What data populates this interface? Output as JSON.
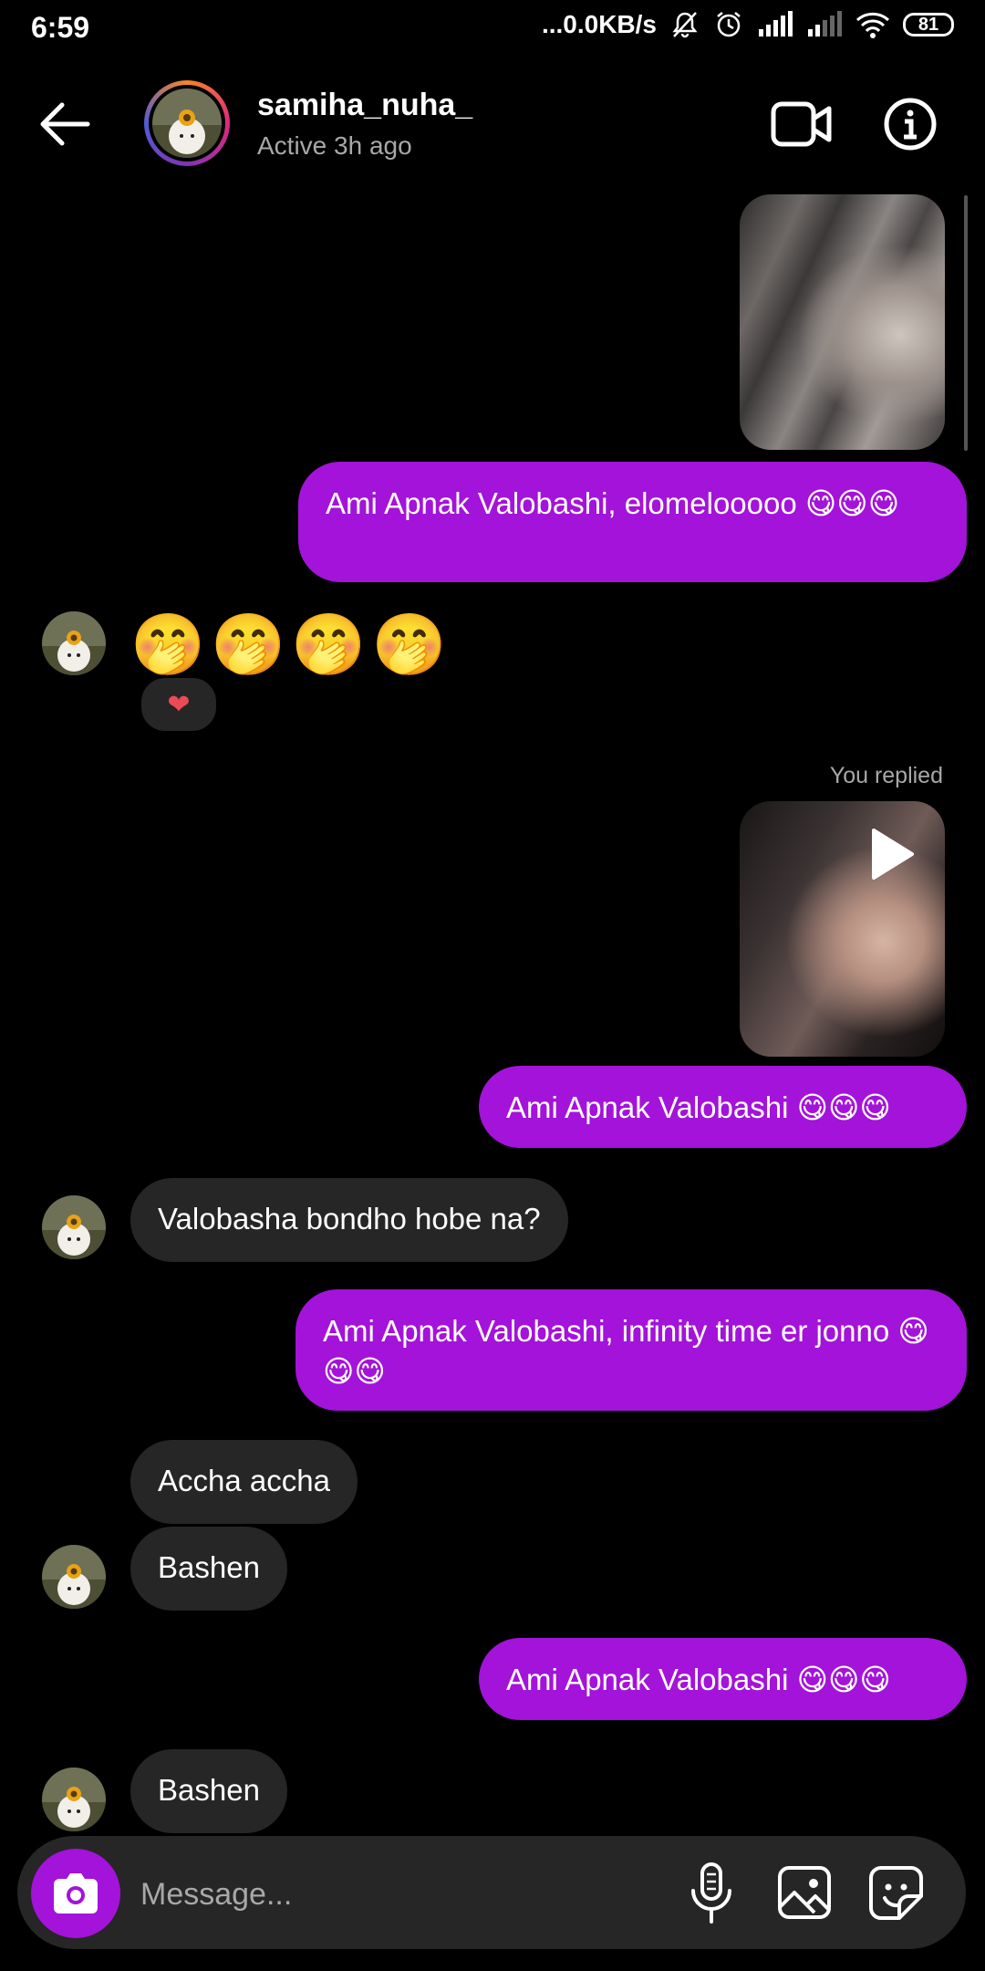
{
  "status_bar": {
    "time": "6:59",
    "network_speed": "...0.0KB/s",
    "battery": "81"
  },
  "header": {
    "username": "samiha_nuha_",
    "presence": "Active 3h ago"
  },
  "messages": [
    {
      "type": "image",
      "direction": "sent"
    },
    {
      "type": "text",
      "direction": "sent",
      "text": "Ami Apnak Valobashi, elomelooooo 😋😋😋"
    },
    {
      "type": "emoji",
      "direction": "received",
      "text": "🤭🤭🤭🤭",
      "reaction": "❤"
    },
    {
      "type": "label",
      "text": "You replied"
    },
    {
      "type": "video",
      "direction": "sent"
    },
    {
      "type": "text",
      "direction": "sent",
      "text": "Ami Apnak Valobashi 😋😋😋"
    },
    {
      "type": "text",
      "direction": "received",
      "text": "Valobasha bondho hobe na?"
    },
    {
      "type": "text",
      "direction": "sent",
      "text": "Ami Apnak Valobashi, infinity time er jonno 😋😋😋"
    },
    {
      "type": "text",
      "direction": "received",
      "text": "Accha accha"
    },
    {
      "type": "text",
      "direction": "received",
      "text": "Bashen"
    },
    {
      "type": "text",
      "direction": "sent",
      "text": "Ami Apnak Valobashi 😋😋😋"
    },
    {
      "type": "text",
      "direction": "received",
      "text": "Bashen"
    }
  ],
  "composer": {
    "placeholder": "Message..."
  },
  "icons": {
    "back": "arrow-left-icon",
    "video_call": "video-camera-icon",
    "info": "info-icon",
    "camera": "camera-icon",
    "mic": "microphone-icon",
    "gallery": "image-icon",
    "sticker": "sticker-icon"
  },
  "colors": {
    "sent_bubble": "#a313d9",
    "received_bubble": "#262626",
    "background": "#000000",
    "secondary_text": "#a8a8a8"
  }
}
